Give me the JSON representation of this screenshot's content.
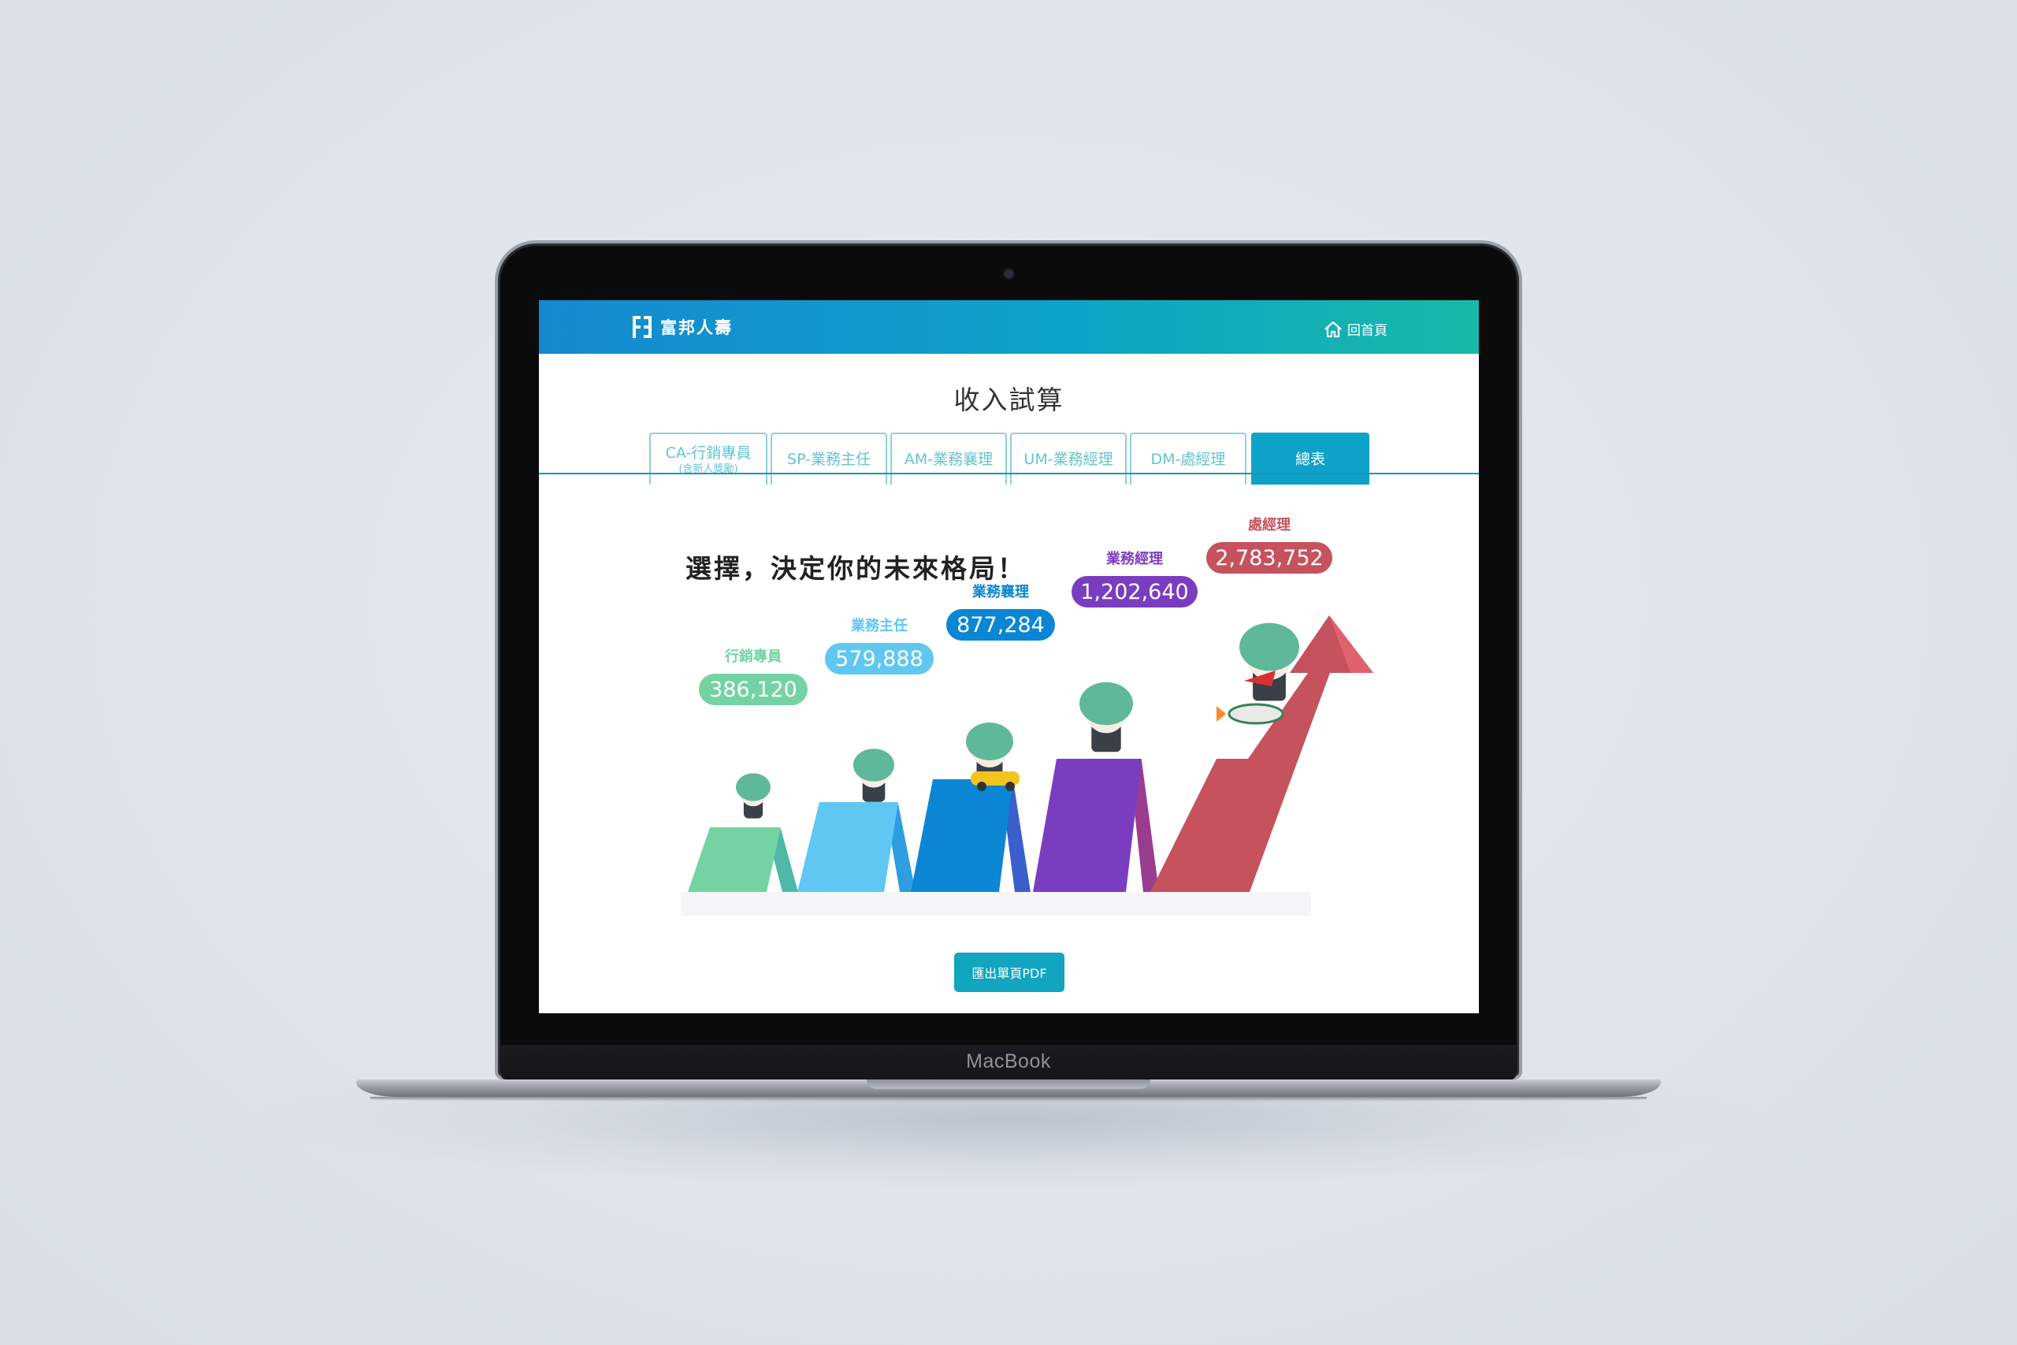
{
  "device": {
    "brand_label": "MacBook"
  },
  "header": {
    "logo_text": "富邦人壽",
    "home_label": "回首頁"
  },
  "page": {
    "title": "收入試算"
  },
  "tabs": [
    {
      "label": "CA-行銷專員",
      "sublabel": "(含新人獎勵)",
      "active": false
    },
    {
      "label": "SP-業務主任",
      "active": false
    },
    {
      "label": "AM-業務襄理",
      "active": false
    },
    {
      "label": "UM-業務經理",
      "active": false
    },
    {
      "label": "DM-處經理",
      "active": false
    },
    {
      "label": "總表",
      "active": true
    }
  ],
  "slogan": "選擇，決定你的未來格局！",
  "chart_data": {
    "type": "bar",
    "categories": [
      "行銷專員",
      "業務主任",
      "業務襄理",
      "業務經理",
      "處經理"
    ],
    "values_display": [
      "386,120",
      "579,888",
      "877,284",
      "1,202,640",
      "2,783,752"
    ],
    "values": [
      386120,
      579888,
      877284,
      1202640,
      2783752
    ],
    "colors": [
      "#74d3a3",
      "#5fc7f2",
      "#0a86d4",
      "#7b3dbf",
      "#c5525d"
    ]
  },
  "actions": {
    "export_label": "匯出單頁PDF"
  }
}
